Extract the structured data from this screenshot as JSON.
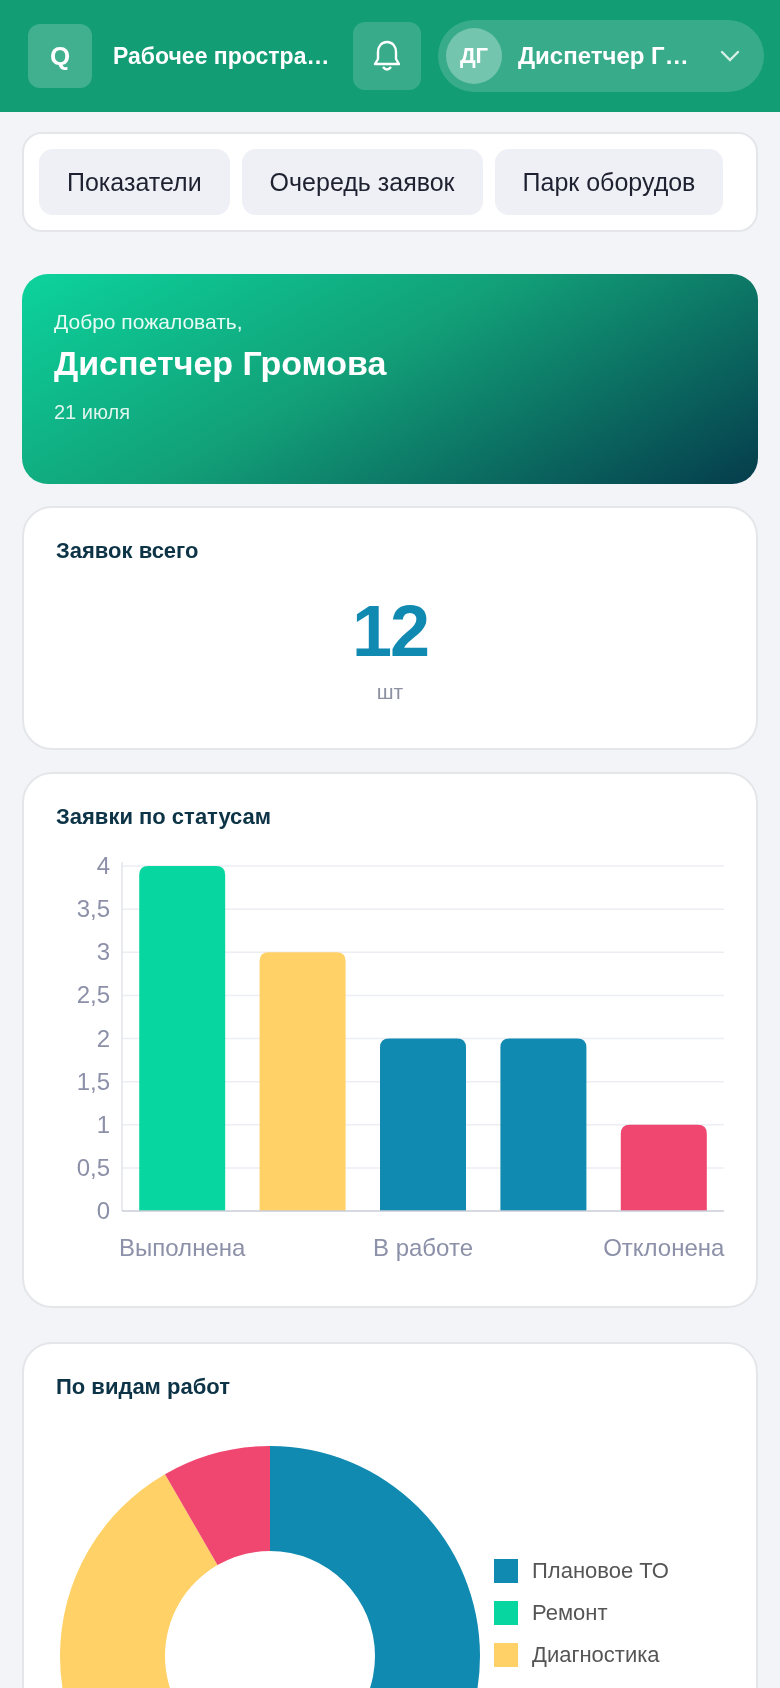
{
  "header": {
    "logo": "Q",
    "title": "Рабочее простра…",
    "user": {
      "initials": "ДГ",
      "name": "Диспетчер Г…"
    }
  },
  "tabs": [
    {
      "label": "Показатели"
    },
    {
      "label": "Очередь заявок"
    },
    {
      "label": "Парк оборудов"
    }
  ],
  "welcome": {
    "greeting": "Добро пожаловать,",
    "name": "Диспетчер Громова",
    "date": "21 июля"
  },
  "total": {
    "title": "Заявок всего",
    "value": "12",
    "unit": "шт"
  },
  "status_chart": {
    "title": "Заявки по статусам",
    "chart_data": {
      "type": "bar",
      "categories": [
        "Выполнена",
        null,
        "В работе",
        null,
        "Отклонена"
      ],
      "grid": true,
      "series": [
        {
          "color": "#08d6a0",
          "values": [
            4,
            null,
            null,
            null,
            null
          ]
        },
        {
          "color": "#ffd166",
          "values": [
            null,
            3,
            null,
            null,
            null
          ]
        },
        {
          "color": "#118ab2",
          "values": [
            null,
            null,
            2,
            2,
            null
          ]
        },
        {
          "color": "#ef476f",
          "values": [
            null,
            null,
            null,
            null,
            1
          ]
        }
      ],
      "ylim": [
        0,
        4
      ],
      "yticks": [
        {
          "value": 0,
          "label": "0"
        },
        {
          "value": 0.5,
          "label": "0,5"
        },
        {
          "value": 1,
          "label": "1"
        },
        {
          "value": 1.5,
          "label": "1,5"
        },
        {
          "value": 2,
          "label": "2"
        },
        {
          "value": 2.5,
          "label": "2,5"
        },
        {
          "value": 3,
          "label": "3"
        },
        {
          "value": 3.5,
          "label": "3,5"
        },
        {
          "value": 4,
          "label": "4"
        }
      ]
    }
  },
  "work_types": {
    "title": "По видам работ",
    "legend": [
      {
        "label": "Плановое ТО",
        "color": "#118ab2"
      },
      {
        "label": "Ремонт",
        "color": "#08d6a0"
      },
      {
        "label": "Диагностика",
        "color": "#ffd166"
      }
    ]
  }
}
